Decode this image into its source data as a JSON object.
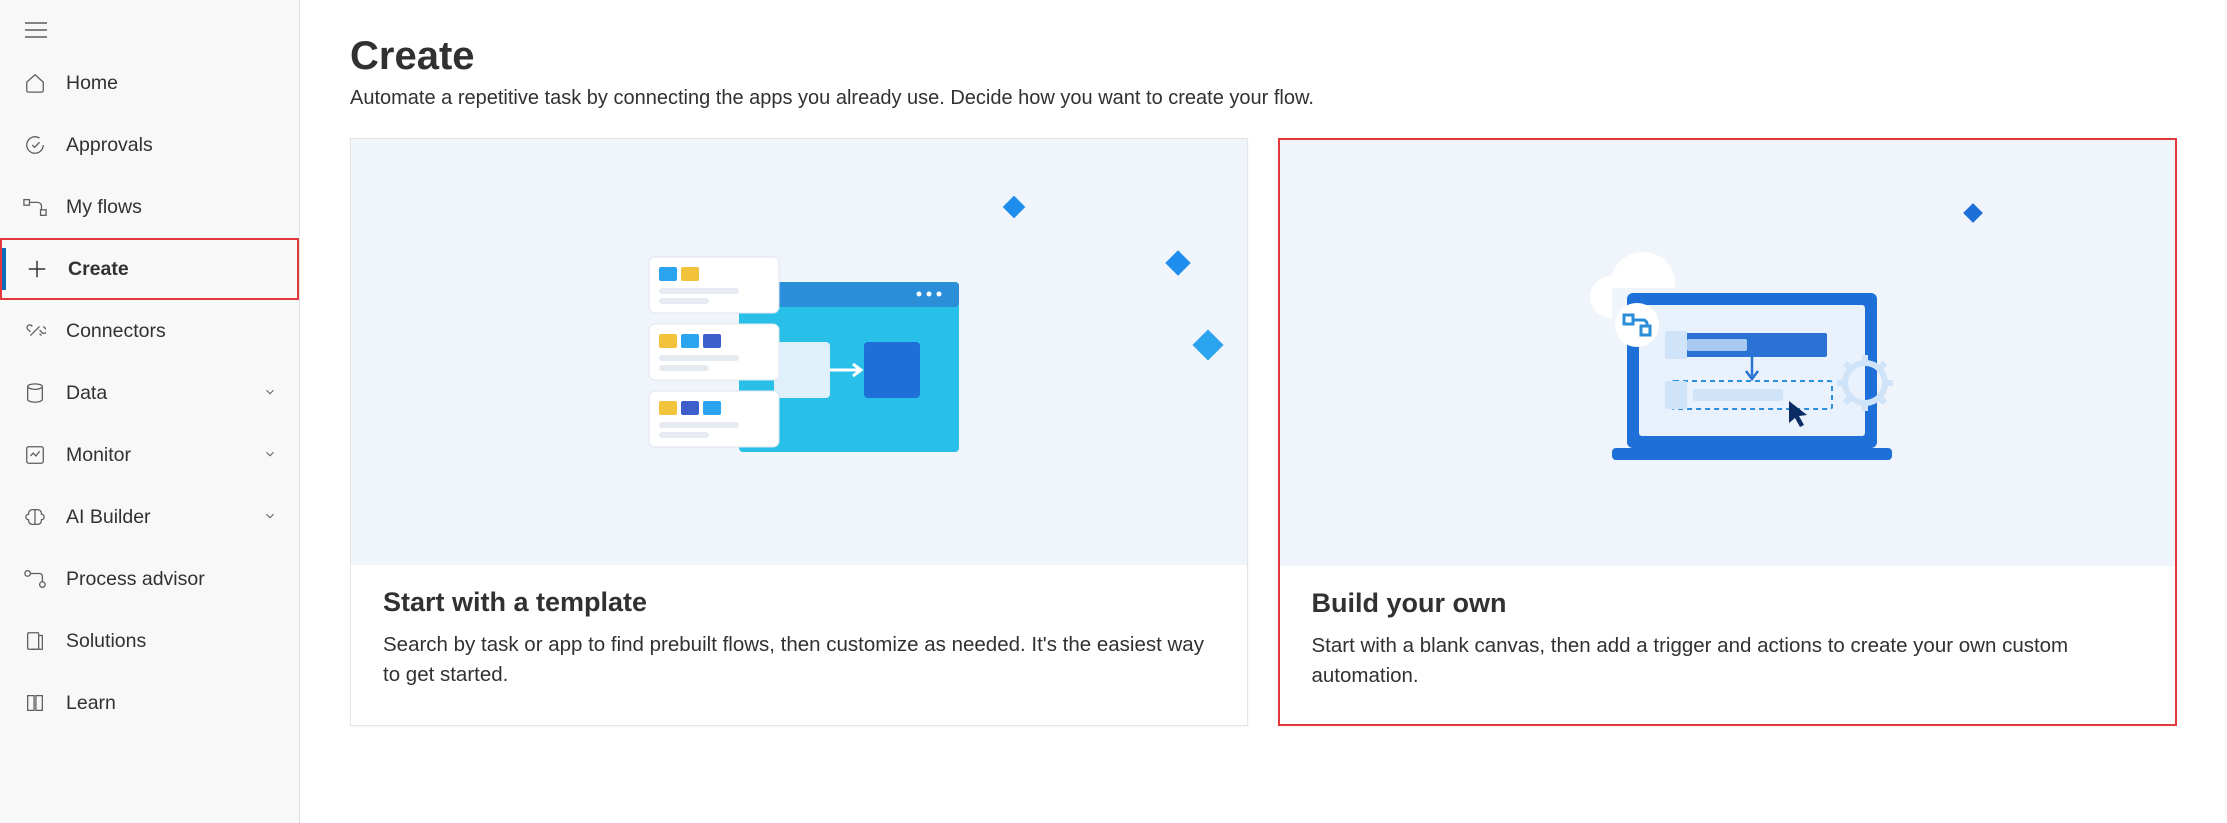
{
  "sidebar": {
    "items": [
      {
        "label": "Home",
        "icon": "home"
      },
      {
        "label": "Approvals",
        "icon": "approvals"
      },
      {
        "label": "My flows",
        "icon": "myflows"
      },
      {
        "label": "Create",
        "icon": "create",
        "active": true,
        "callout": true
      },
      {
        "label": "Connectors",
        "icon": "connectors"
      },
      {
        "label": "Data",
        "icon": "data",
        "expandable": true
      },
      {
        "label": "Monitor",
        "icon": "monitor",
        "expandable": true
      },
      {
        "label": "AI Builder",
        "icon": "aibuilder",
        "expandable": true
      },
      {
        "label": "Process advisor",
        "icon": "processadvisor"
      },
      {
        "label": "Solutions",
        "icon": "solutions"
      },
      {
        "label": "Learn",
        "icon": "learn"
      }
    ]
  },
  "page": {
    "title": "Create",
    "subtitle": "Automate a repetitive task by connecting the apps you already use. Decide how you want to create your flow."
  },
  "cards": [
    {
      "title": "Start with a template",
      "desc": "Search by task or app to find prebuilt flows, then customize as needed. It's the easiest way to get started.",
      "highlight": false
    },
    {
      "title": "Build your own",
      "desc": "Start with a blank canvas, then add a trigger and actions to create your own custom automation.",
      "highlight": true
    }
  ]
}
